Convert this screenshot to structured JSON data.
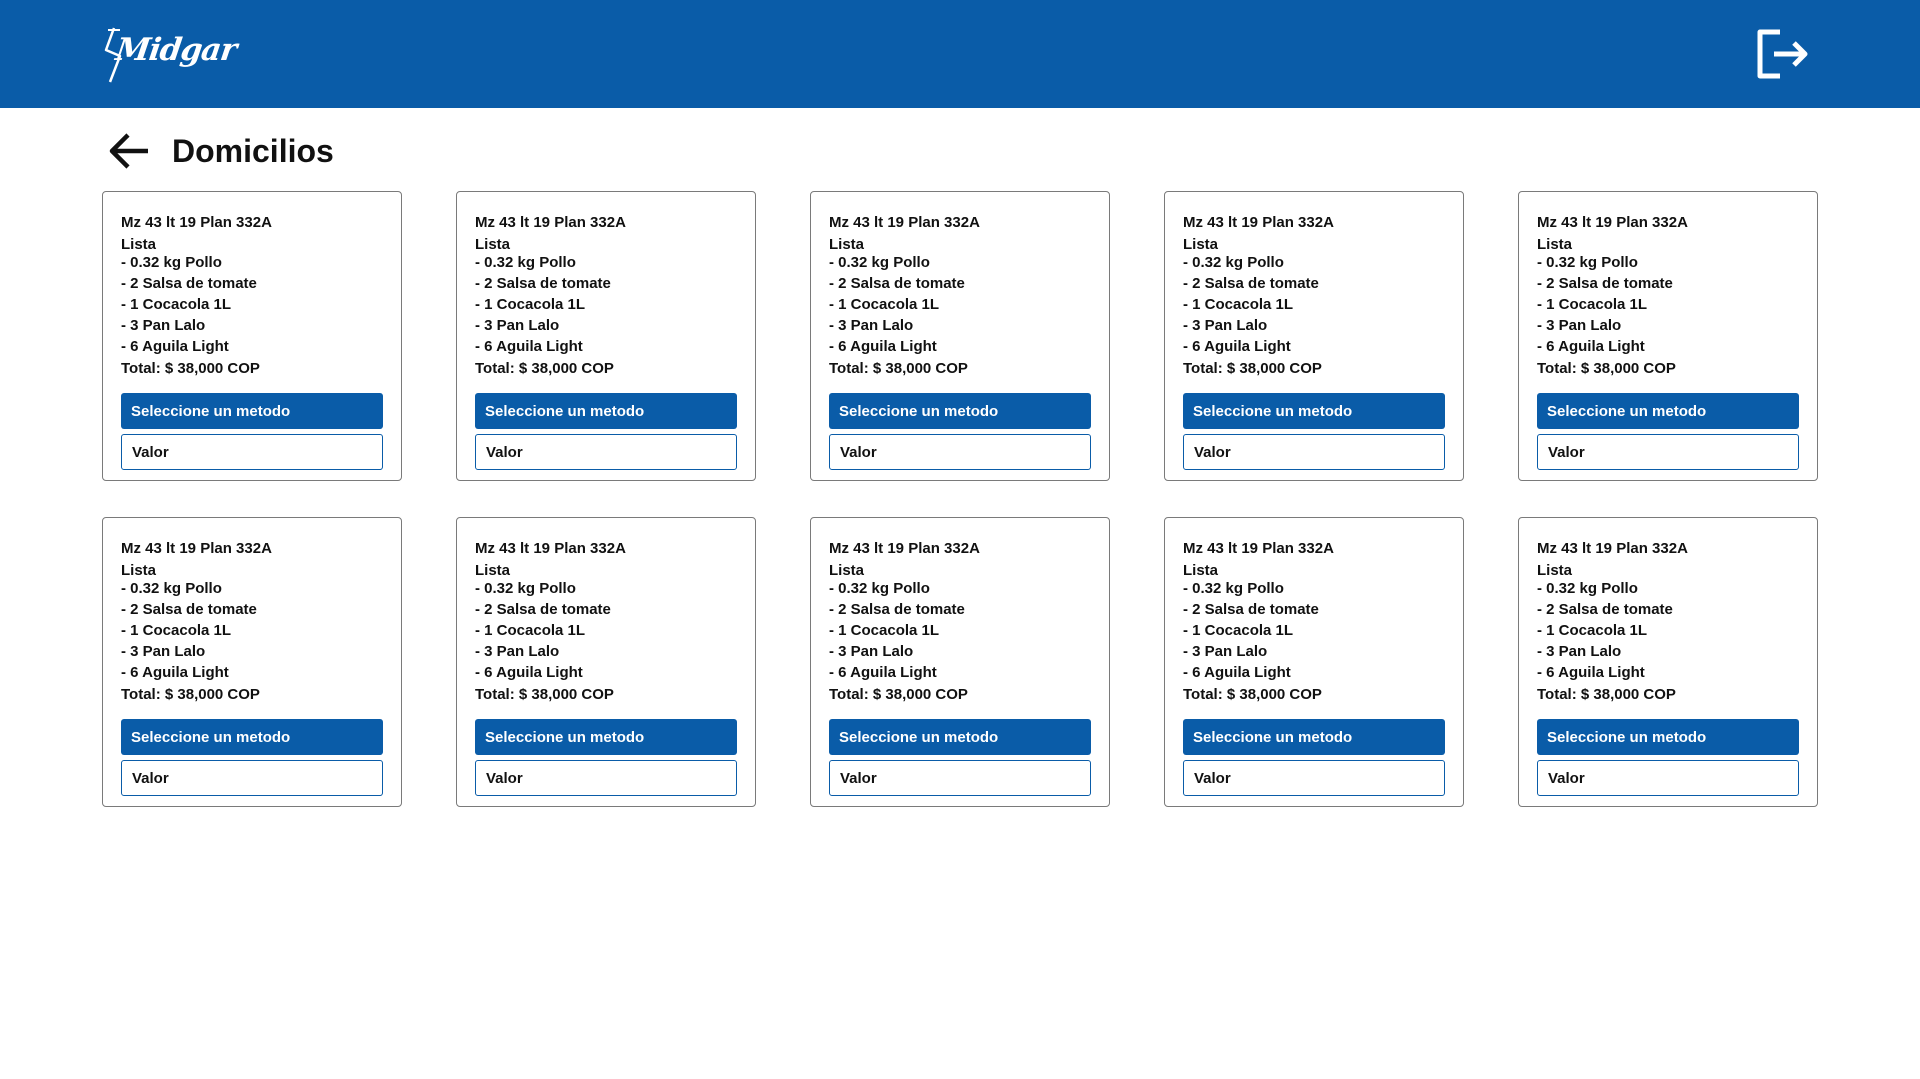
{
  "header": {
    "brand": "Midgar",
    "logout_icon": "logout-icon"
  },
  "page": {
    "title": "Domicilios",
    "back_icon": "arrow-left-icon"
  },
  "colors": {
    "primary": "#0a5ca8",
    "card_border": "#7a7a7a",
    "background": "#ffffff"
  },
  "cards": [
    {
      "address": "Mz 43 lt 19 Plan 332A",
      "list_label": "Lista",
      "items": [
        "- 0.32 kg Pollo",
        "- 2 Salsa de tomate",
        "- 1 Cocacola 1L",
        "- 3 Pan Lalo",
        "- 6 Aguila Light"
      ],
      "total": "Total: $ 38,000 COP",
      "method_label": "Seleccione un metodo",
      "valor_placeholder": "Valor"
    },
    {
      "address": "Mz 43 lt 19 Plan 332A",
      "list_label": "Lista",
      "items": [
        "- 0.32 kg Pollo",
        "- 2 Salsa de tomate",
        "- 1 Cocacola 1L",
        "- 3 Pan Lalo",
        "- 6 Aguila Light"
      ],
      "total": "Total: $ 38,000 COP",
      "method_label": "Seleccione un metodo",
      "valor_placeholder": "Valor"
    },
    {
      "address": "Mz 43 lt 19 Plan 332A",
      "list_label": "Lista",
      "items": [
        "- 0.32 kg Pollo",
        "- 2 Salsa de tomate",
        "- 1 Cocacola 1L",
        "- 3 Pan Lalo",
        "- 6 Aguila Light"
      ],
      "total": "Total: $ 38,000 COP",
      "method_label": "Seleccione un metodo",
      "valor_placeholder": "Valor"
    },
    {
      "address": "Mz 43 lt 19 Plan 332A",
      "list_label": "Lista",
      "items": [
        "- 0.32 kg Pollo",
        "- 2 Salsa de tomate",
        "- 1 Cocacola 1L",
        "- 3 Pan Lalo",
        "- 6 Aguila Light"
      ],
      "total": "Total: $ 38,000 COP",
      "method_label": "Seleccione un metodo",
      "valor_placeholder": "Valor"
    },
    {
      "address": "Mz 43 lt 19 Plan 332A",
      "list_label": "Lista",
      "items": [
        "- 0.32 kg Pollo",
        "- 2 Salsa de tomate",
        "- 1 Cocacola 1L",
        "- 3 Pan Lalo",
        "- 6 Aguila Light"
      ],
      "total": "Total: $ 38,000 COP",
      "method_label": "Seleccione un metodo",
      "valor_placeholder": "Valor"
    },
    {
      "address": "Mz 43 lt 19 Plan 332A",
      "list_label": "Lista",
      "items": [
        "- 0.32 kg Pollo",
        "- 2 Salsa de tomate",
        "- 1 Cocacola 1L",
        "- 3 Pan Lalo",
        "- 6 Aguila Light"
      ],
      "total": "Total: $ 38,000 COP",
      "method_label": "Seleccione un metodo",
      "valor_placeholder": "Valor"
    },
    {
      "address": "Mz 43 lt 19 Plan 332A",
      "list_label": "Lista",
      "items": [
        "- 0.32 kg Pollo",
        "- 2 Salsa de tomate",
        "- 1 Cocacola 1L",
        "- 3 Pan Lalo",
        "- 6 Aguila Light"
      ],
      "total": "Total: $ 38,000 COP",
      "method_label": "Seleccione un metodo",
      "valor_placeholder": "Valor"
    },
    {
      "address": "Mz 43 lt 19 Plan 332A",
      "list_label": "Lista",
      "items": [
        "- 0.32 kg Pollo",
        "- 2 Salsa de tomate",
        "- 1 Cocacola 1L",
        "- 3 Pan Lalo",
        "- 6 Aguila Light"
      ],
      "total": "Total: $ 38,000 COP",
      "method_label": "Seleccione un metodo",
      "valor_placeholder": "Valor"
    },
    {
      "address": "Mz 43 lt 19 Plan 332A",
      "list_label": "Lista",
      "items": [
        "- 0.32 kg Pollo",
        "- 2 Salsa de tomate",
        "- 1 Cocacola 1L",
        "- 3 Pan Lalo",
        "- 6 Aguila Light"
      ],
      "total": "Total: $ 38,000 COP",
      "method_label": "Seleccione un metodo",
      "valor_placeholder": "Valor"
    },
    {
      "address": "Mz 43 lt 19 Plan 332A",
      "list_label": "Lista",
      "items": [
        "- 0.32 kg Pollo",
        "- 2 Salsa de tomate",
        "- 1 Cocacola 1L",
        "- 3 Pan Lalo",
        "- 6 Aguila Light"
      ],
      "total": "Total: $ 38,000 COP",
      "method_label": "Seleccione un metodo",
      "valor_placeholder": "Valor"
    }
  ]
}
